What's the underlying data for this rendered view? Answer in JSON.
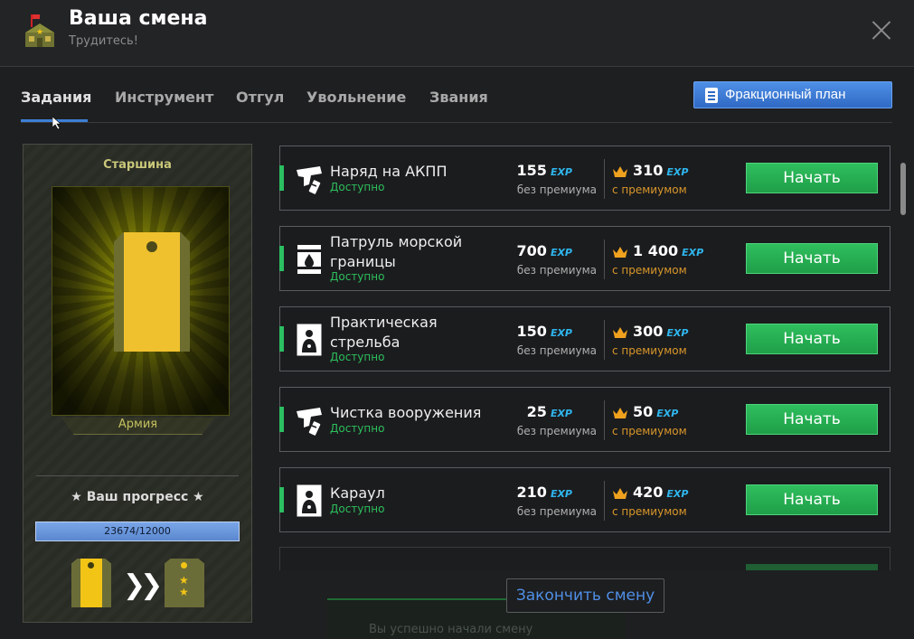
{
  "header": {
    "title": "Ваша смена",
    "subtitle": "Трудитесь!"
  },
  "tabs": [
    {
      "label": "Задания",
      "active": true
    },
    {
      "label": "Инструмент",
      "active": false
    },
    {
      "label": "Отгул",
      "active": false
    },
    {
      "label": "Увольнение",
      "active": false
    },
    {
      "label": "Звания",
      "active": false
    }
  ],
  "faction_plan_label": "Фракционный план",
  "rank": {
    "name": "Старшина",
    "faction": "Армия"
  },
  "progress": {
    "title": "★ Ваш прогресс ★",
    "current": 23674,
    "required": 12000,
    "text": "23674/12000"
  },
  "exp_label": "EXP",
  "base_caption": "без премиума",
  "premium_caption": "с премиумом",
  "start_label": "Начать",
  "tasks": [
    {
      "name": "Наряд на АКПП",
      "status": "Доступно",
      "base": "155",
      "premium": "310",
      "icon": "pistol-icon"
    },
    {
      "name": "Патруль морской границы",
      "status": "Доступно",
      "base": "700",
      "premium": "1 400",
      "icon": "oil-barrel-icon"
    },
    {
      "name": "Практическая стрельба",
      "status": "Доступно",
      "base": "150",
      "premium": "300",
      "icon": "shooting-target-icon"
    },
    {
      "name": "Чистка вооружения",
      "status": "Доступно",
      "base": "25",
      "premium": "50",
      "icon": "pistol-icon"
    },
    {
      "name": "Караул",
      "status": "Доступно",
      "base": "210",
      "premium": "420",
      "icon": "shooting-target-icon"
    }
  ],
  "finish_label": "Закончить смену",
  "toast_text": "Вы успешно начали смену",
  "colors": {
    "accent_blue": "#3d7fd6",
    "start_green": "#2bbf62",
    "exp_blue": "#2fb6ee",
    "premium_orange": "#d9972a",
    "rank_yellow": "#f0c12e"
  }
}
